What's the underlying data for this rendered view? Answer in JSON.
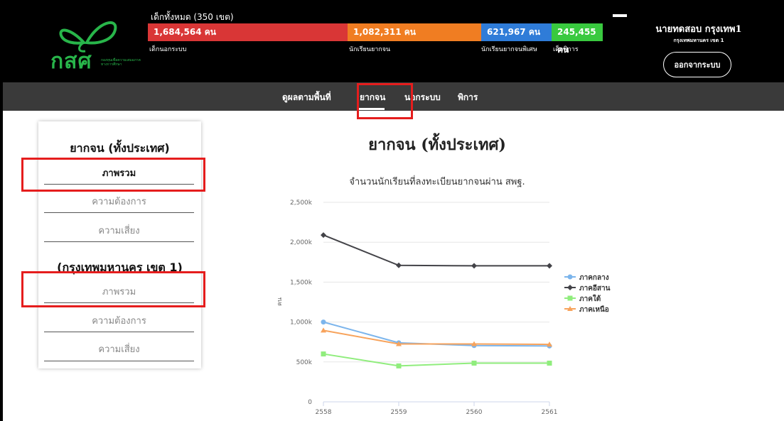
{
  "header": {
    "total_label": "เด็กทั้งหมด (350 เขต)",
    "logo_text": "กสศ",
    "logo_sub": "กองทุนเพื่อความเสมอภาคทางการศึกษา",
    "stats": [
      {
        "value": "1,684,564 คน",
        "label": "เด็กนอกระบบ",
        "color": "#d93636"
      },
      {
        "value": "1,082,311 คน",
        "label": "นักเรียนยากจน",
        "color": "#f07d22"
      },
      {
        "value": "621,967 คน",
        "label": "นักเรียนยากจนพิเศษ",
        "color": "#2f7cd8"
      },
      {
        "value": "245,455 คน",
        "label": "เด็กพิการ",
        "color": "#39c93f"
      }
    ],
    "user_name": "นายทดสอบ กรุงเทพ1",
    "user_dept": "กรุงเทพมหานคร เขต 1",
    "logout_label": "ออกจากระบบ"
  },
  "nav": {
    "items": [
      "ดูผลตามพื้นที่",
      "ยากจน",
      "นอกระบบ",
      "พิการ"
    ],
    "active": "ยากจน"
  },
  "sidebar": {
    "section1_title": "ยากจน (ทั้งประเทศ)",
    "section1_items": [
      "ภาพรวม",
      "ความต้องการ",
      "ความเสี่ยง"
    ],
    "section2_title": "(กรุงเทพมหานคร เขต 1)",
    "section2_items": [
      "ภาพรวม",
      "ความต้องการ",
      "ความเสี่ยง"
    ]
  },
  "main": {
    "title": "ยากจน (ทั้งประเทศ)"
  },
  "chart_data": {
    "type": "line",
    "title": "จำนวนนักเรียนที่ลงทะเบียนยากจนผ่าน สพฐ.",
    "xlabel": "",
    "ylabel": "คน",
    "x": [
      "2558",
      "2559",
      "2560",
      "2561"
    ],
    "ylim": [
      0,
      2500000
    ],
    "yticks": [
      0,
      500000,
      1000000,
      1500000,
      2000000,
      2500000
    ],
    "ytick_labels": [
      "0",
      "500k",
      "1,000k",
      "1,500k",
      "2,000k",
      "2,500k"
    ],
    "grid": true,
    "legend": "right",
    "series": [
      {
        "name": "ภาคกลาง",
        "values": [
          1000000,
          740000,
          705000,
          700000
        ],
        "color": "#7cb5ec",
        "marker": "circle"
      },
      {
        "name": "ภาคอีสาน",
        "values": [
          2090000,
          1710000,
          1705000,
          1705000
        ],
        "color": "#434348",
        "marker": "diamond"
      },
      {
        "name": "ภาคใต้",
        "values": [
          600000,
          450000,
          485000,
          485000
        ],
        "color": "#90ed7d",
        "marker": "square"
      },
      {
        "name": "ภาคเหนือ",
        "values": [
          895000,
          725000,
          725000,
          720000
        ],
        "color": "#f7a35c",
        "marker": "triangle"
      }
    ]
  }
}
